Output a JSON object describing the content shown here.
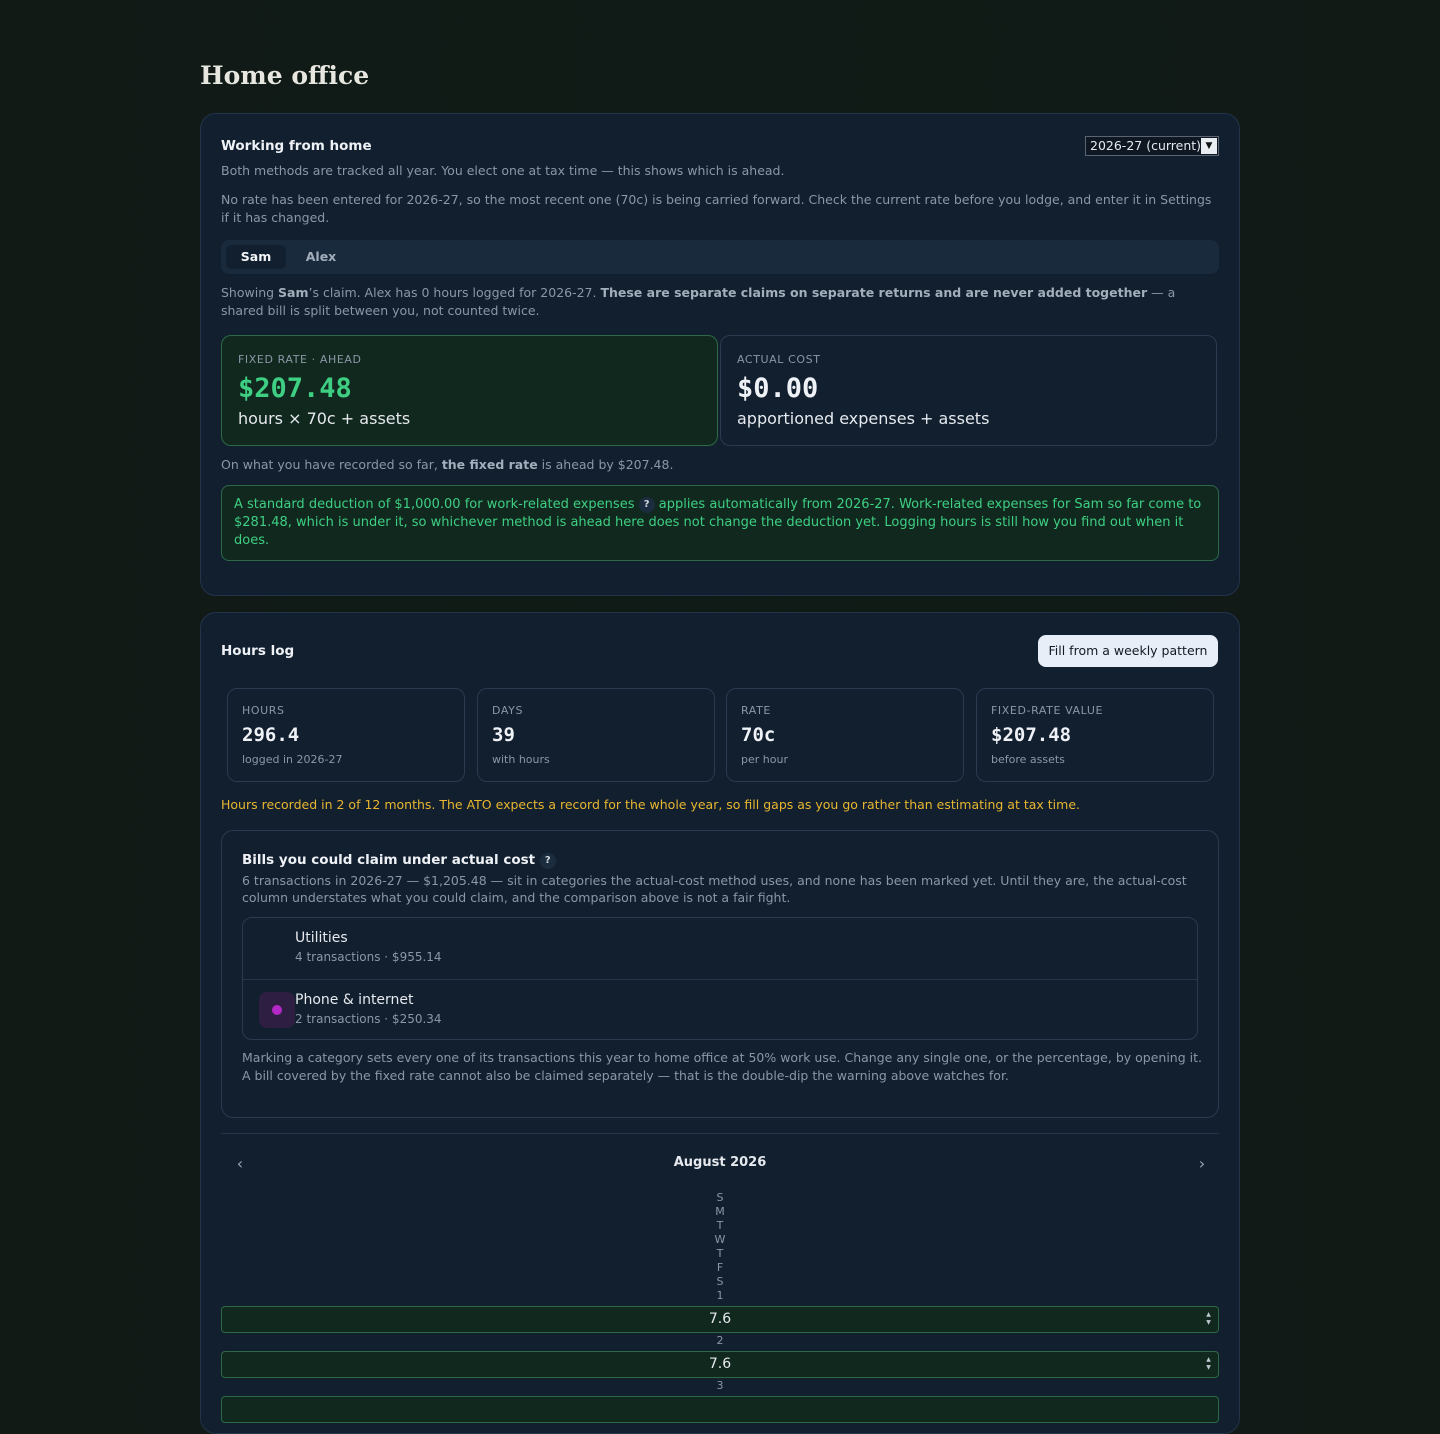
{
  "page": {
    "title": "Home office"
  },
  "wfh": {
    "title": "Working from home",
    "year_select": "2026-27 (current)",
    "desc": "Both methods are tracked all year. You elect one at tax time — this shows which is ahead.",
    "rate_note": "No rate has been entered for 2026-27, so the most recent one (70c) is being carried forward. Check the current rate before you lodge, and enter it in Settings if it has changed.",
    "tabs": [
      "Sam",
      "Alex"
    ],
    "showing": {
      "p1": "Showing ",
      "name": "Sam",
      "p2": "’s claim. Alex has 0 hours logged for 2026-27. ",
      "bold": "These are separate claims on separate returns and are never added together",
      "p3": " — a shared bill is split between you, not counted twice."
    },
    "fixed": {
      "label": "FIXED RATE · AHEAD",
      "value": "$207.48",
      "sub": "hours × 70c + assets"
    },
    "actual": {
      "label": "ACTUAL COST",
      "value": "$0.00",
      "sub": "apportioned expenses + assets"
    },
    "compare": {
      "p1": "On what you have recorded so far, ",
      "bold": "the fixed rate",
      "p2": " is ahead by $207.48."
    },
    "notice": {
      "p1": "A standard deduction of $1,000.00 for work-related expenses ",
      "q": "?",
      "p2": " applies automatically from 2026-27. Work-related expenses for Sam so far come to $281.48, which is under it, so whichever method is ahead here does not change the deduction yet. Logging hours is still how you find out when it does."
    }
  },
  "hours": {
    "title": "Hours log",
    "fill_button": "Fill from a weekly pattern",
    "stats": [
      {
        "label": "HOURS",
        "value": "296.4",
        "sub": "logged in 2026-27"
      },
      {
        "label": "DAYS",
        "value": "39",
        "sub": "with hours"
      },
      {
        "label": "RATE",
        "value": "70c",
        "sub": "per hour"
      },
      {
        "label": "FIXED-RATE VALUE",
        "value": "$207.48",
        "sub": "before assets"
      }
    ],
    "warning": "Hours recorded in 2 of 12 months. The ATO expects a record for the whole year, so fill gaps as you go rather than estimating at tax time.",
    "bills": {
      "title": "Bills you could claim under actual cost",
      "q": "?",
      "desc": "6 transactions in 2026-27 — $1,205.48 — sit in categories the actual-cost method uses, and none has been marked yet. Until they are, the actual-cost column understates what you could claim, and the comparison above is not a fair fight.",
      "categories": [
        {
          "name": "Utilities",
          "meta": "4 transactions · $955.14"
        },
        {
          "name": "Phone & internet",
          "meta": "2 transactions · $250.34",
          "color": "#b328c6"
        }
      ],
      "footer": "Marking a category sets every one of its transactions this year to home office at 50% work use. Change any single one, or the percentage, by opening it. A bill covered by the fixed rate cannot also be claimed separately — that is the double-dip the warning above watches for."
    },
    "calendar": {
      "prev_icon": "‹",
      "next_icon": "›",
      "month": "August 2026",
      "weekdays": [
        "S",
        "M",
        "T",
        "W",
        "T",
        "F",
        "S"
      ],
      "days": [
        {
          "day": "1",
          "hours": "7.6"
        },
        {
          "day": "2",
          "hours": "7.6"
        },
        {
          "day": "3",
          "hours": ""
        }
      ]
    }
  },
  "colors": {
    "accent_green": "#3ecf82",
    "warning": "#e8b62f",
    "card_bg": "#111f2f"
  }
}
